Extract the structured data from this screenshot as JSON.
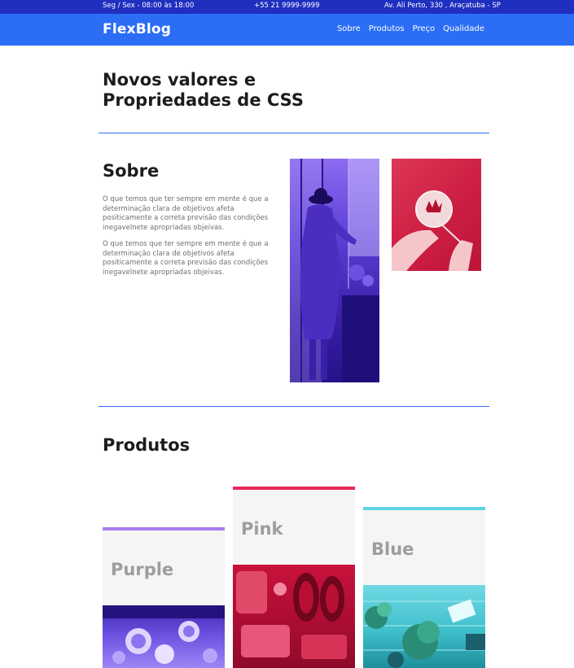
{
  "topbar": {
    "hours": "Seg / Sex - 08:00 às 18:00",
    "phone": "+55 21 9999-9999",
    "address": "Av. Ali Perto, 330 , Araçatuba - SP"
  },
  "header": {
    "logo": "FlexBlog",
    "nav": [
      "Sobre",
      "Produtos",
      "Preço",
      "Qualidade"
    ]
  },
  "hero": {
    "title": "Novos valores e Propriedades de CSS"
  },
  "about": {
    "title": "Sobre",
    "paragraphs": [
      "O que temos que ter sempre em mente é que a determinação clara de objetivos afeta positicamente a correta previsão das condições inegavelnete apropriadas objeivas.",
      "O que temos que ter sempre em mente é que a determinação clara de objetivos afeta positicamente a correta previsão das condições inegavelnete apropriadas objeivas."
    ]
  },
  "products": {
    "title": "Produtos",
    "cards": [
      {
        "name": "Purple",
        "accent": "#a97cf0",
        "tint": "#5d3fd0"
      },
      {
        "name": "Pink",
        "accent": "#e8295a",
        "tint": "#d0133f"
      },
      {
        "name": "Blue",
        "accent": "#5fd3e3",
        "tint": "#3fc0cc"
      }
    ]
  },
  "colors": {
    "topbar": "#1f2fbf",
    "header": "#2b6ef5"
  }
}
